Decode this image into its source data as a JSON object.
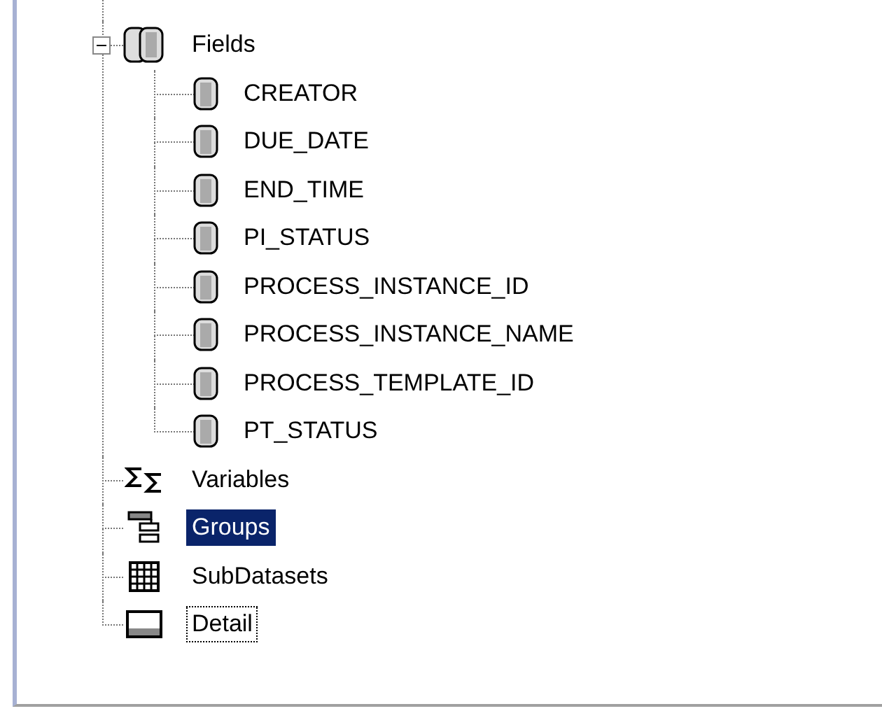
{
  "tree": [
    {
      "label": "Fields",
      "kind": "fields",
      "expanded": true,
      "selected": false,
      "focused": false,
      "children": [
        {
          "label": "CREATOR",
          "kind": "field",
          "selected": false,
          "focused": false
        },
        {
          "label": "DUE_DATE",
          "kind": "field",
          "selected": false,
          "focused": false
        },
        {
          "label": "END_TIME",
          "kind": "field",
          "selected": false,
          "focused": false
        },
        {
          "label": "PI_STATUS",
          "kind": "field",
          "selected": false,
          "focused": false
        },
        {
          "label": "PROCESS_INSTANCE_ID",
          "kind": "field",
          "selected": false,
          "focused": false
        },
        {
          "label": "PROCESS_INSTANCE_NAME",
          "kind": "field",
          "selected": false,
          "focused": false
        },
        {
          "label": "PROCESS_TEMPLATE_ID",
          "kind": "field",
          "selected": false,
          "focused": false
        },
        {
          "label": "PT_STATUS",
          "kind": "field",
          "selected": false,
          "focused": false
        }
      ]
    },
    {
      "label": "Variables",
      "kind": "variables",
      "selected": false,
      "focused": false
    },
    {
      "label": "Groups",
      "kind": "groups",
      "selected": true,
      "focused": false
    },
    {
      "label": "SubDatasets",
      "kind": "subdatasets",
      "selected": false,
      "focused": false
    },
    {
      "label": "Detail",
      "kind": "detail",
      "selected": false,
      "focused": true
    }
  ]
}
